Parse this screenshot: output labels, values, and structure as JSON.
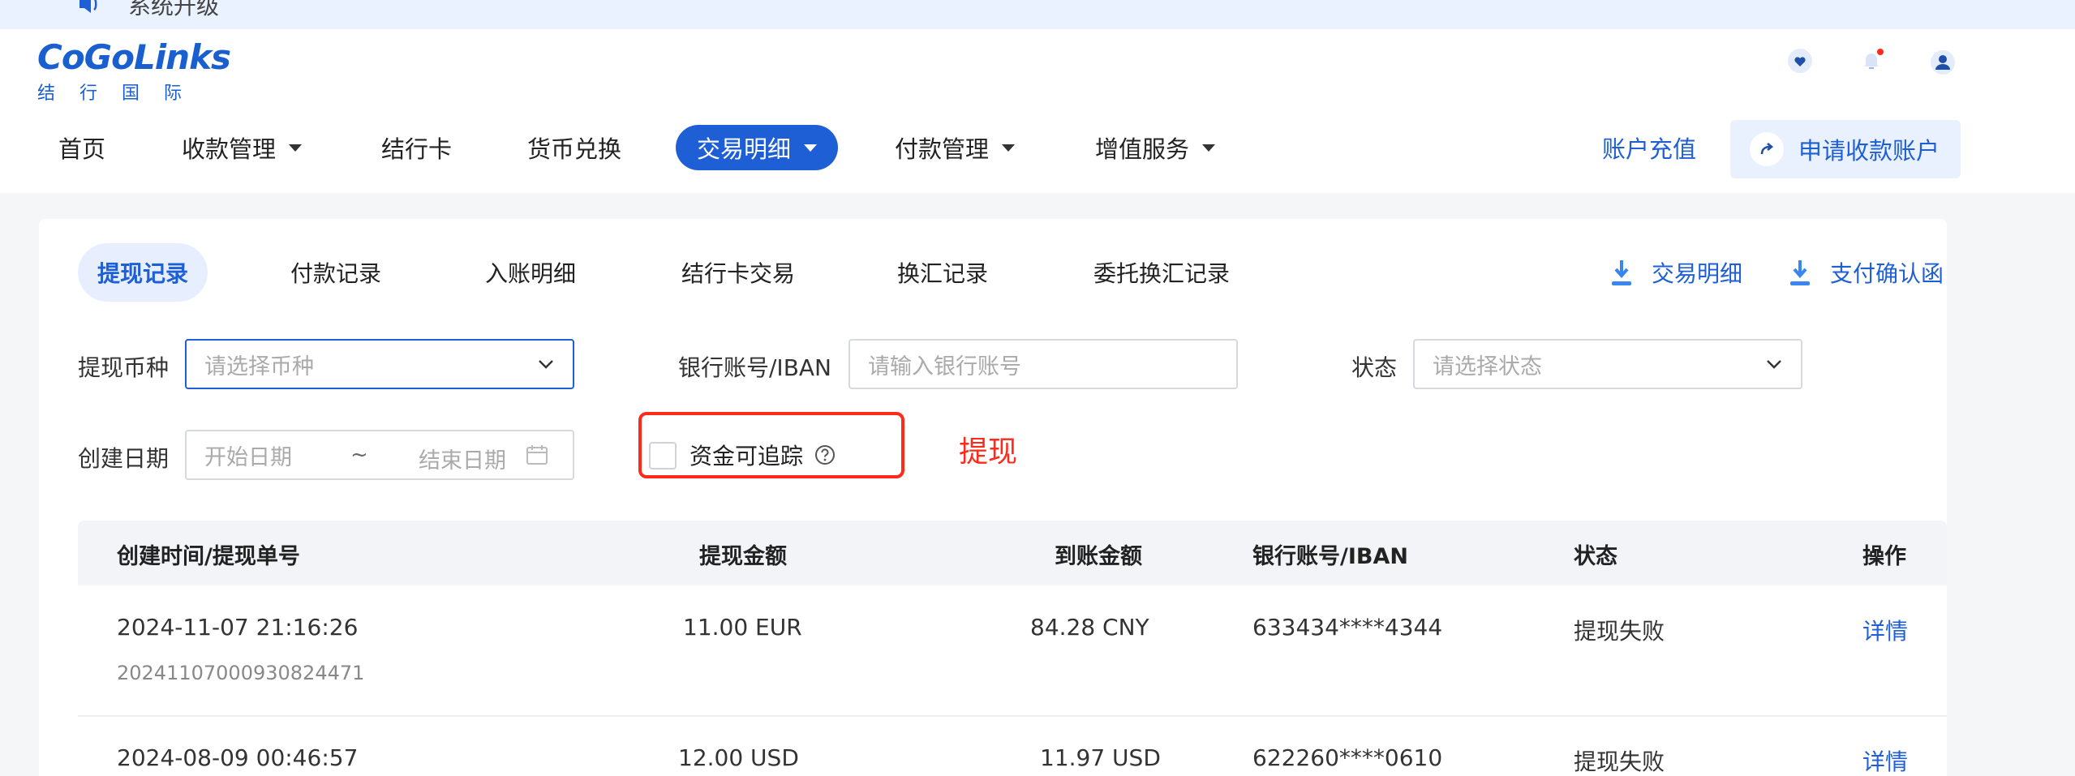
{
  "notice": {
    "text": "系统升级"
  },
  "logo": {
    "brand": "CoGoLinks",
    "sub": "结行国际"
  },
  "header_icons": [
    "heart-icon",
    "bell-icon",
    "user-icon"
  ],
  "nav": {
    "items": [
      {
        "label": "首页",
        "dropdown": false
      },
      {
        "label": "收款管理",
        "dropdown": true
      },
      {
        "label": "结行卡",
        "dropdown": false
      },
      {
        "label": "货币兑换",
        "dropdown": false
      },
      {
        "label": "交易明细",
        "dropdown": true,
        "active": true
      },
      {
        "label": "付款管理",
        "dropdown": true
      },
      {
        "label": "增值服务",
        "dropdown": true
      }
    ],
    "recharge": "账户充值",
    "apply": "申请收款账户"
  },
  "tabs": [
    "提现记录",
    "付款记录",
    "入账明细",
    "结行卡交易",
    "换汇记录",
    "委托换汇记录"
  ],
  "downloads": [
    "交易明细",
    "支付确认函"
  ],
  "filters": {
    "currency_label": "提现币种",
    "currency_placeholder": "请选择币种",
    "bank_label": "银行账号/IBAN",
    "bank_placeholder": "请输入银行账号",
    "status_label": "状态",
    "status_placeholder": "请选择状态",
    "date_label": "创建日期",
    "date_start": "开始日期",
    "date_sep": "~",
    "date_end": "结束日期",
    "traceable": "资金可追踪"
  },
  "annotation": "提现",
  "table": {
    "headers": [
      "创建时间/提现单号",
      "提现金额",
      "到账金额",
      "银行账号/IBAN",
      "状态",
      "操作"
    ],
    "rows": [
      {
        "time": "2024-11-07 21:16:26",
        "no": "20241107000930824471",
        "amount": "11.00 EUR",
        "received": "84.28 CNY",
        "account": "633434****4344",
        "status": "提现失败",
        "action": "详情"
      },
      {
        "time": "2024-08-09 00:46:57",
        "no": "",
        "amount": "12.00 USD",
        "received": "11.97 USD",
        "account": "622260****0610",
        "status": "提现失败",
        "action": "详情"
      }
    ]
  },
  "colors": {
    "primary": "#1f5fd6",
    "annotation": "#ff2a1a"
  }
}
